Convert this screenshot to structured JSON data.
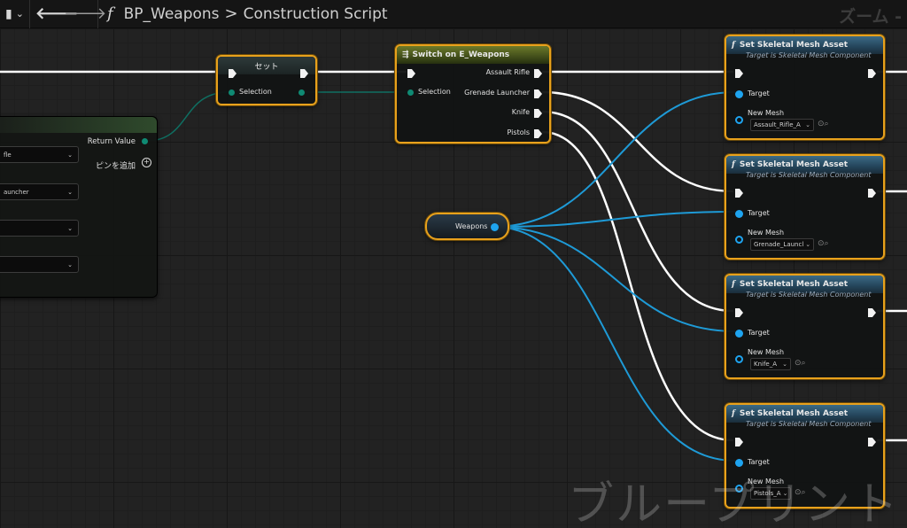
{
  "toolbar": {
    "bookmark_icon": "bookmark-icon",
    "back_icon": "arrow-left-icon",
    "forward_icon": "arrow-right-icon",
    "function_icon": "f",
    "blueprint_name": "BP_Weapons",
    "separator": ">",
    "graph_name": "Construction Script",
    "zoom_label": "ズーム -"
  },
  "left_node": {
    "return_value_label": "Return Value",
    "add_pin_label": "ピンを追加",
    "dropdowns": [
      "fle",
      "auncher",
      "",
      ""
    ]
  },
  "set_node": {
    "title": "セット",
    "selection_label": "Selection"
  },
  "switch_node": {
    "title": "Switch on E_Weapons",
    "selection_label": "Selection",
    "outputs": [
      "Assault Rifle",
      "Grenade Launcher",
      "Knife",
      "Pistols"
    ]
  },
  "weapons_var": {
    "label": "Weapons"
  },
  "mesh_nodes": [
    {
      "title": "Set Skeletal Mesh Asset",
      "subtitle": "Target is Skeletal Mesh Component",
      "target_label": "Target",
      "new_mesh_label": "New Mesh",
      "mesh_value": "Assault_Rifle_A"
    },
    {
      "title": "Set Skeletal Mesh Asset",
      "subtitle": "Target is Skeletal Mesh Component",
      "target_label": "Target",
      "new_mesh_label": "New Mesh",
      "mesh_value": "Grenade_Launcl"
    },
    {
      "title": "Set Skeletal Mesh Asset",
      "subtitle": "Target is Skeletal Mesh Component",
      "target_label": "Target",
      "new_mesh_label": "New Mesh",
      "mesh_value": "Knife_A"
    },
    {
      "title": "Set Skeletal Mesh Asset",
      "subtitle": "Target is Skeletal Mesh Component",
      "target_label": "Target",
      "new_mesh_label": "New Mesh",
      "mesh_value": "Pistols_A"
    }
  ],
  "watermark": "ブループリント",
  "colors": {
    "exec_wire": "#ffffff",
    "object_wire": "#1e9ad6",
    "enum_wire": "#0f6f62",
    "selected_border": "#e8a11c"
  }
}
